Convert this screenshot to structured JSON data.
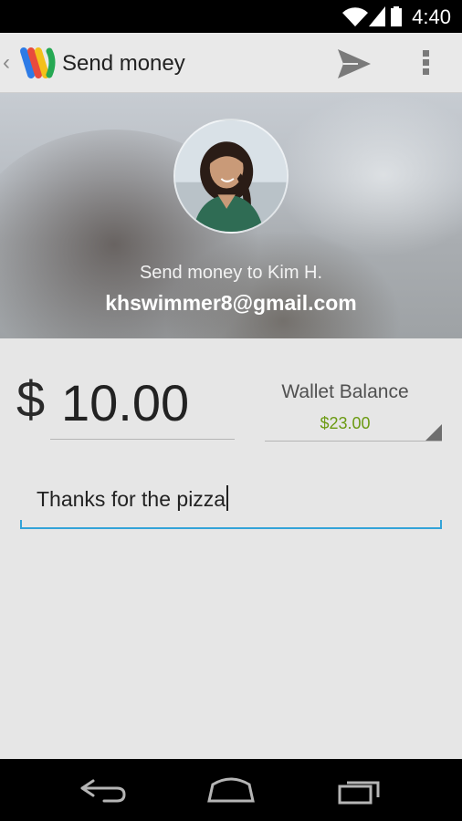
{
  "status_bar": {
    "time": "4:40",
    "icons": [
      "wifi-icon",
      "signal-icon",
      "battery-icon"
    ]
  },
  "action_bar": {
    "title": "Send money",
    "icons": [
      "up-caret-icon",
      "google-wallet-logo",
      "send-icon",
      "overflow-menu-icon"
    ]
  },
  "recipient": {
    "send_to_label": "Send money to Kim H.",
    "email": "khswimmer8@gmail.com"
  },
  "payment": {
    "currency_symbol": "$",
    "amount": "10.00",
    "funding_source_label": "Wallet Balance",
    "funding_source_value": "$23.00"
  },
  "memo": {
    "value": "Thanks for the pizza"
  },
  "colors": {
    "balance_green": "#6b9a12",
    "accent_blue": "#33a3d8"
  },
  "navigation_bar": {
    "icons": [
      "back-icon",
      "home-icon",
      "recent-apps-icon"
    ]
  }
}
